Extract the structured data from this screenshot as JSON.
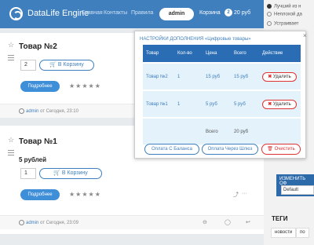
{
  "header": {
    "logo_text": "DataLife Engine",
    "nav": [
      "Главная",
      "Контакты",
      "Правила"
    ],
    "login_label": "admin",
    "cart_label": "Корзина",
    "cart_count": "2",
    "cart_total": "20 руб"
  },
  "sidebar": {
    "poll_options": [
      "Лучший из н",
      "Неплохой да",
      "Устраивает"
    ],
    "change_style_title": "ИЗМЕНИТЬ ОФ",
    "style_value": "Default",
    "tags_title": "ТЕГИ",
    "tags": [
      "новости",
      "по"
    ]
  },
  "items": [
    {
      "title": "Товар №2",
      "qty": "2",
      "cart_button": "В Корзину",
      "more_button": "Подробнее",
      "rating": "★★★★★",
      "author": "admin",
      "date": "от Сегодня, 23:10"
    },
    {
      "title": "Товар №1",
      "price": "5 рублей",
      "qty": "1",
      "cart_button": "В Корзину",
      "more_button": "Подробнее",
      "rating": "★★★★★",
      "author": "admin",
      "date": "от Сегодня, 23:09"
    }
  ],
  "modal": {
    "title": "НАСТРОЙКИ ДОПОЛНЕНИЯ «Цифровые товары»",
    "close": "×",
    "columns": [
      "Товар",
      "Кол-во",
      "Цена",
      "Всего",
      "Действие"
    ],
    "rows": [
      {
        "product": "Товар №2",
        "qty": "1",
        "price": "15 руб",
        "total": "15 руб",
        "action": "Удалить"
      },
      {
        "product": "Товар №1",
        "qty": "1",
        "price": "5 руб",
        "total": "5 руб",
        "action": "Удалить"
      }
    ],
    "total_label": "Всего",
    "total_value": "20 руб",
    "buttons": {
      "pay_balance": "Оплата С Баланса",
      "pay_webmoney": "Оплата Через Шлюз",
      "clear": "Очистить"
    }
  },
  "colors": {
    "header_bg": "#3f7fbe",
    "table_head": "#2a6db5",
    "row_bg": "#e4f2fb",
    "danger": "#dd3333"
  }
}
